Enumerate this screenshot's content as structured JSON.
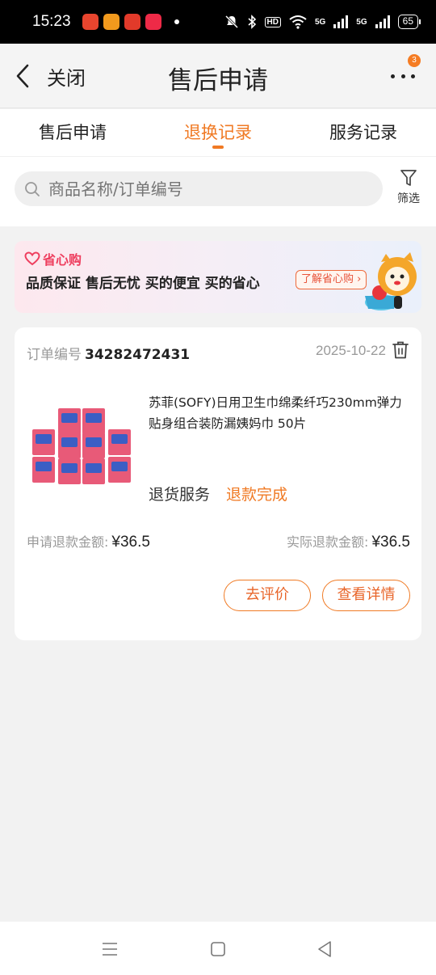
{
  "status_bar": {
    "time": "15:23",
    "hd": "HD",
    "network_1": "5G",
    "network_2": "5G",
    "battery": "65",
    "app_icons": [
      "toutiao-app-icon",
      "wechat-app-icon",
      "hongbao-app-icon",
      "xiaohongshu-app-icon"
    ]
  },
  "header": {
    "close_label": "关闭",
    "title": "售后申请",
    "badge_count": "3"
  },
  "tabs": [
    {
      "label": "售后申请",
      "active": false
    },
    {
      "label": "退换记录",
      "active": true
    },
    {
      "label": "服务记录",
      "active": false
    }
  ],
  "search": {
    "placeholder": "商品名称/订单编号",
    "filter_label": "筛选"
  },
  "banner": {
    "brand": "省心购",
    "slogan": "品质保证 售后无忧  买的便宜 买的省心",
    "link": "了解省心购 ›"
  },
  "order": {
    "order_no_label": "订单编号",
    "order_no": "34282472431",
    "date": "2025-10-22",
    "product_title": "苏菲(SOFY)日用卫生巾绵柔纤巧230mm弹力贴身组合装防漏姨妈巾 50片",
    "service_type": "退货服务",
    "service_status": "退款完成",
    "apply_label": "申请退款金额:",
    "apply_amount": "¥36.5",
    "actual_label": "实际退款金额:",
    "actual_amount": "¥36.5",
    "review_button": "去评价",
    "detail_button": "查看详情"
  },
  "colors": {
    "accent": "#f07a24",
    "banner_brand": "#ee3e5e",
    "background": "#f2f2f2"
  },
  "nav_bar": {
    "icons": [
      "menu-icon",
      "home-icon",
      "back-icon"
    ]
  }
}
